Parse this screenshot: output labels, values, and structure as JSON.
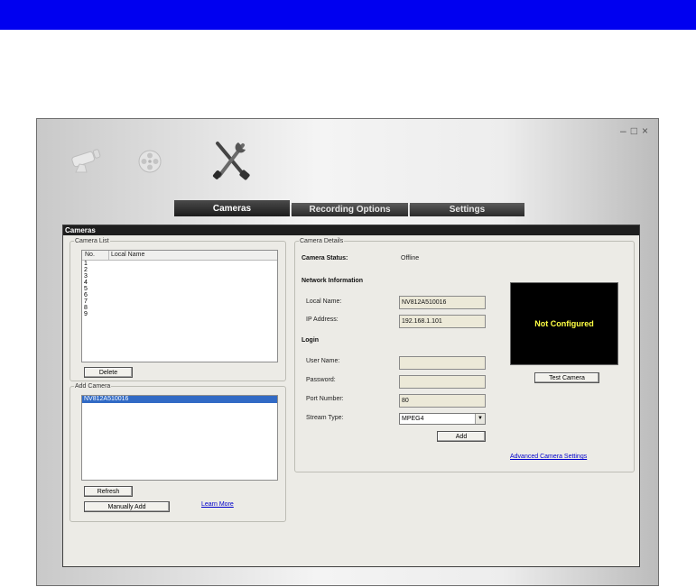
{
  "window": {
    "controls": {
      "minimize": "–",
      "maximize": "□",
      "close": "×"
    }
  },
  "icons": {
    "camera": "camera-icon",
    "film": "film-reel-icon",
    "tools": "tools-icon"
  },
  "tabs": [
    {
      "label": "Cameras",
      "active": true
    },
    {
      "label": "Recording Options",
      "active": false
    },
    {
      "label": "Settings",
      "active": false
    }
  ],
  "content": {
    "title": "Cameras"
  },
  "camera_list": {
    "legend": "Camera List",
    "columns": [
      "No.",
      "Local Name"
    ],
    "rows": [
      "1",
      "2",
      "3",
      "4",
      "5",
      "6",
      "7",
      "8",
      "9"
    ],
    "delete_label": "Delete"
  },
  "add_camera": {
    "legend": "Add Camera",
    "selected_item": "NV812A510016",
    "refresh_label": "Refresh",
    "manually_add_label": "Manually Add",
    "learn_more": "Learn More"
  },
  "details": {
    "legend": "Camera Details",
    "status_label": "Camera Status:",
    "status_value": "Offline",
    "network_heading": "Network Information",
    "local_name_label": "Local Name:",
    "local_name_value": "NV812A510016",
    "ip_label": "IP Address:",
    "ip_value": "192.168.1.101",
    "login_heading": "Login",
    "user_label": "User Name:",
    "user_value": "",
    "password_label": "Password:",
    "password_value": "",
    "port_label": "Port Number:",
    "port_value": "80",
    "stream_label": "Stream Type:",
    "stream_value": "MPEG4",
    "add_label": "Add",
    "preview_text": "Not Configured",
    "test_label": "Test Camera",
    "advanced_link": "Advanced Camera Settings"
  },
  "colors": {
    "top_bar": "#0000f0",
    "selection": "#316ac5",
    "preview_text": "#ffff44",
    "link": "#0000cc"
  }
}
